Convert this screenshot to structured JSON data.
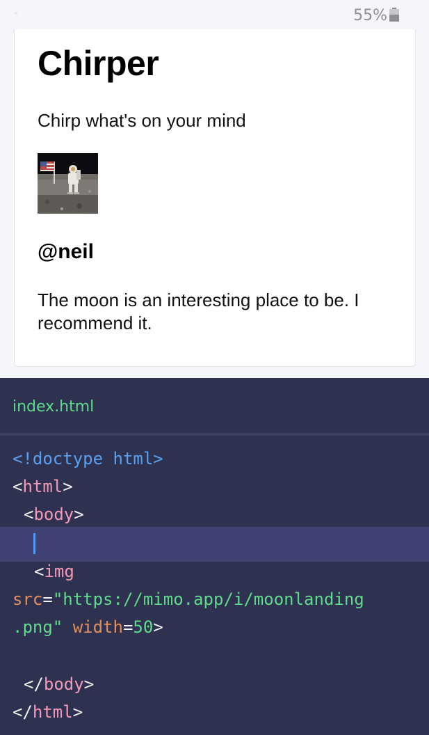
{
  "status_bar": {
    "battery_percent": "55%",
    "battery_level": 0.55
  },
  "preview": {
    "title": "Chirper",
    "prompt": "Chirp what's on your mind",
    "post": {
      "handle": "@neil",
      "text": "The moon is an interesting place to be. I recommend it."
    }
  },
  "editor": {
    "filename": "index.html",
    "code": {
      "doctype_open": "<!doctype",
      "doctype_word": " html",
      "doctype_close": ">",
      "html_open_lt": "<",
      "html_open_tag": "html",
      "html_open_gt": ">",
      "body_open_lt": "<",
      "body_open_tag": "body",
      "body_open_gt": ">",
      "img_lt": "<",
      "img_tag": "img",
      "src_attr": "src",
      "eq1": "=",
      "src_value_1": "\"https://mimo.app/i/moonlanding",
      "src_value_2": ".png\"",
      "width_attr": "width",
      "eq2": "=",
      "width_value": "50",
      "img_gt": ">",
      "body_close_lt": "</",
      "body_close_tag": "body",
      "body_close_gt": ">",
      "html_close_lt": "</",
      "html_close_tag": "html",
      "html_close_gt": ">"
    }
  },
  "colors": {
    "editor_bg": "#2e3150",
    "active_line": "#3f4272",
    "tag_pink": "#f49ab8",
    "keyword_blue": "#5aa0f2",
    "attr_orange": "#e58e58",
    "string_green": "#5ddc8c"
  }
}
